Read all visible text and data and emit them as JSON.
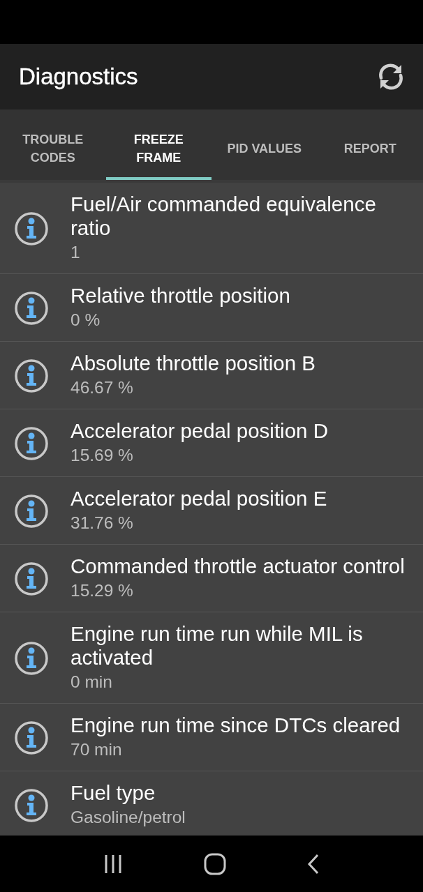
{
  "app_bar": {
    "title": "Diagnostics"
  },
  "tabs": [
    {
      "label": "TROUBLE CODES",
      "selected": false
    },
    {
      "label": "FREEZE FRAME",
      "selected": true
    },
    {
      "label": "PID VALUES",
      "selected": false
    },
    {
      "label": "REPORT",
      "selected": false
    }
  ],
  "items": [
    {
      "name": "Fuel/Air commanded equivalence ratio",
      "value": "1"
    },
    {
      "name": "Relative throttle position",
      "value": "0 %"
    },
    {
      "name": "Absolute throttle position B",
      "value": "46.67 %"
    },
    {
      "name": "Accelerator pedal position D",
      "value": "15.69 %"
    },
    {
      "name": "Accelerator pedal position E",
      "value": "31.76 %"
    },
    {
      "name": "Commanded throttle actuator control",
      "value": "15.29 %"
    },
    {
      "name": "Engine run time run while MIL is activated",
      "value": "0 min"
    },
    {
      "name": "Engine run time since DTCs cleared",
      "value": "70 min"
    },
    {
      "name": "Fuel type",
      "value": "Gasoline/petrol"
    }
  ]
}
